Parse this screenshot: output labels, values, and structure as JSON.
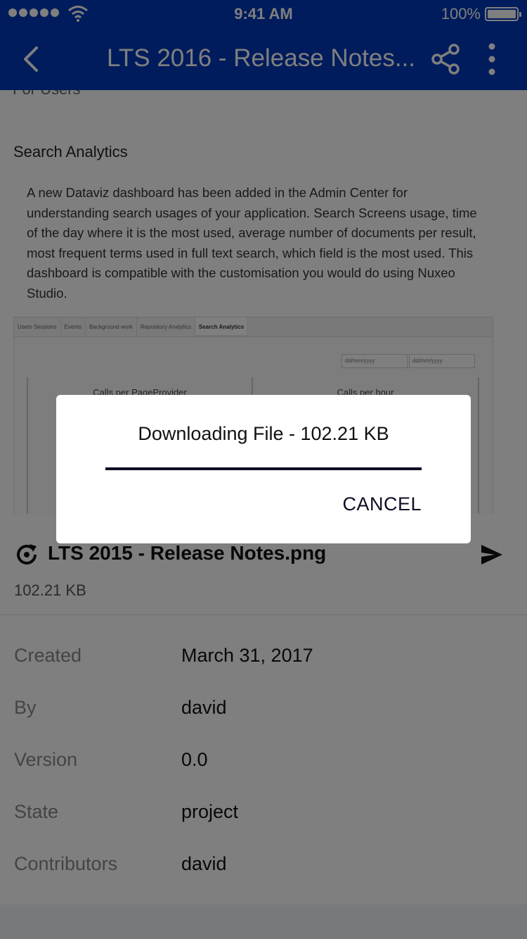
{
  "status_bar": {
    "time": "9:41 AM",
    "battery": "100%"
  },
  "header": {
    "title": "LTS 2016 - Release Notes...",
    "back_icon": "back-arrow-icon",
    "share_icon": "share-icon",
    "more_icon": "more-vertical-icon"
  },
  "preview": {
    "cut_heading": "For Users",
    "section_heading": "Search Analytics",
    "section_body": "A new Dataviz dashboard has been added in the Admin Center for understanding search usages of your application. Search Screens usage, time of the day where it is the most used, average number of documents per result, most frequent terms used in full text search, which field is the most used. This dashboard is compatible with the customisation you would do using Nuxeo Studio.",
    "screenshot": {
      "tabs": [
        "Users Sessions",
        "Events",
        "Background work",
        "Repository Analytics",
        "Search Analytics"
      ],
      "active_tab": "Search Analytics",
      "date_from": "dd/mm/yyyy",
      "date_to": "dd/mm/yyyy",
      "panel_left_title": "Calls per PageProvider",
      "panel_right_title": "Calls per hour"
    }
  },
  "file": {
    "name": "LTS 2015 - Release Notes.png",
    "size": "102.21 KB",
    "status_icon": "sync-icon",
    "action_icon": "send-icon"
  },
  "metadata": [
    {
      "label": "Created",
      "value": "March 31, 2017"
    },
    {
      "label": "By",
      "value": "david"
    },
    {
      "label": "Version",
      "value": "0.0"
    },
    {
      "label": "State",
      "value": "project"
    },
    {
      "label": "Contributors",
      "value": "david"
    }
  ],
  "dialog": {
    "message": "Downloading File - 102.21 KB",
    "progress": 1.0,
    "cancel_label": "CANCEL"
  },
  "colors": {
    "header_background": "#0038b8",
    "overlay": "rgba(0,0,0,0.5)",
    "progress_fill": "#0d0d24"
  }
}
